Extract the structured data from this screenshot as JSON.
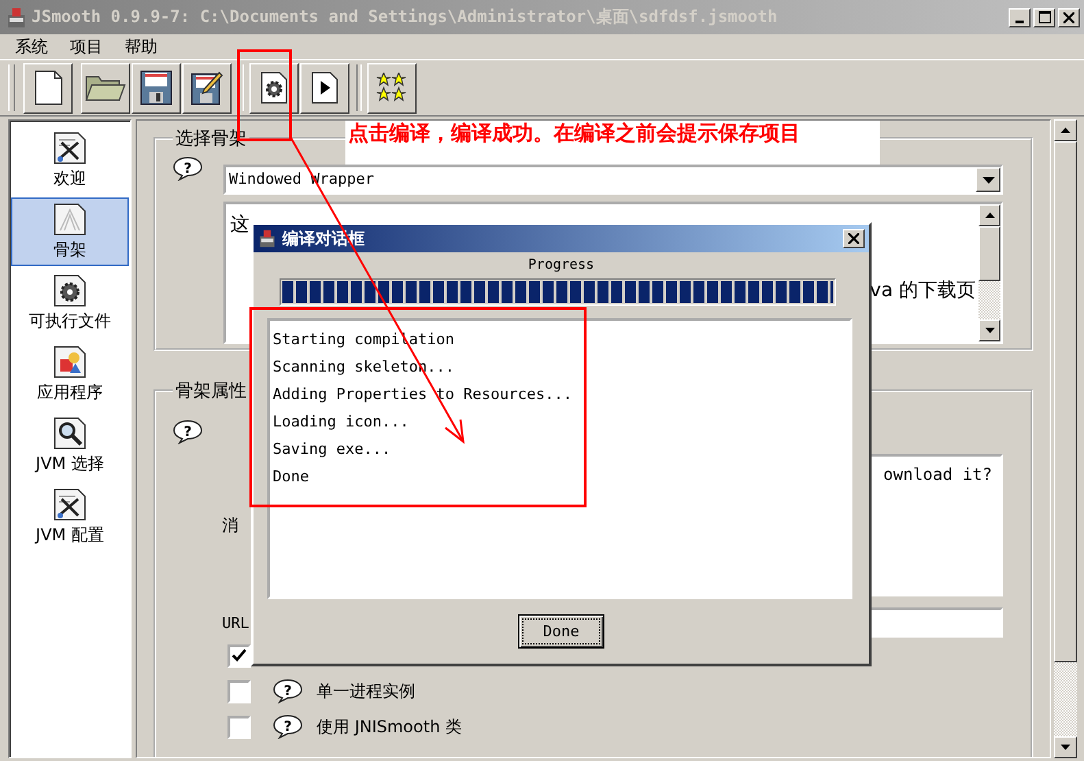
{
  "window": {
    "title": "JSmooth 0.9.9-7: C:\\Documents and Settings\\Administrator\\桌面\\sdfdsf.jsmooth"
  },
  "menu": [
    "系统",
    "项目",
    "帮助"
  ],
  "toolbar": [
    {
      "kind": "new"
    },
    {
      "kind": "open"
    },
    {
      "kind": "save"
    },
    {
      "kind": "save-as"
    },
    {
      "kind": "compile"
    },
    {
      "kind": "run"
    },
    {
      "kind": "about"
    }
  ],
  "sidebar": {
    "items": [
      {
        "label": "欢迎",
        "kind": "tools",
        "selected": false
      },
      {
        "label": "骨架",
        "kind": "page",
        "selected": true
      },
      {
        "label": "可执行文件",
        "kind": "gear",
        "selected": false
      },
      {
        "label": "应用程序",
        "kind": "shapes",
        "selected": false
      },
      {
        "label": "JVM 选择",
        "kind": "magnifier",
        "selected": false
      },
      {
        "label": "JVM 配置",
        "kind": "tools",
        "selected": false
      }
    ]
  },
  "skeleton_group": {
    "legend": "选择骨架",
    "help": "?",
    "skeleton": "Windowed Wrapper",
    "description_start": "这",
    "description_end": "va 的下载页"
  },
  "properties_group": {
    "legend": "骨架属性",
    "help": "?",
    "message_label": "消",
    "message_end": "ownload it?",
    "url_label": "URL",
    "options": [
      {
        "checked": true
      },
      {
        "label": "单一进程实例",
        "help": "?",
        "checked": false
      },
      {
        "label": "使用 JNISmooth 类",
        "help": "?",
        "checked": false
      }
    ]
  },
  "dialog": {
    "title": "编译对话框",
    "progress_label": "Progress",
    "level": 1,
    "log": [
      "Starting compilation",
      "Scanning skeleton...",
      "Adding Properties to Resources...",
      "Loading icon...",
      "Saving exe...",
      "Done"
    ],
    "button": "Done"
  },
  "annotation": {
    "note": "点击编译，编译成功。在编译之前会提示保存项目"
  }
}
